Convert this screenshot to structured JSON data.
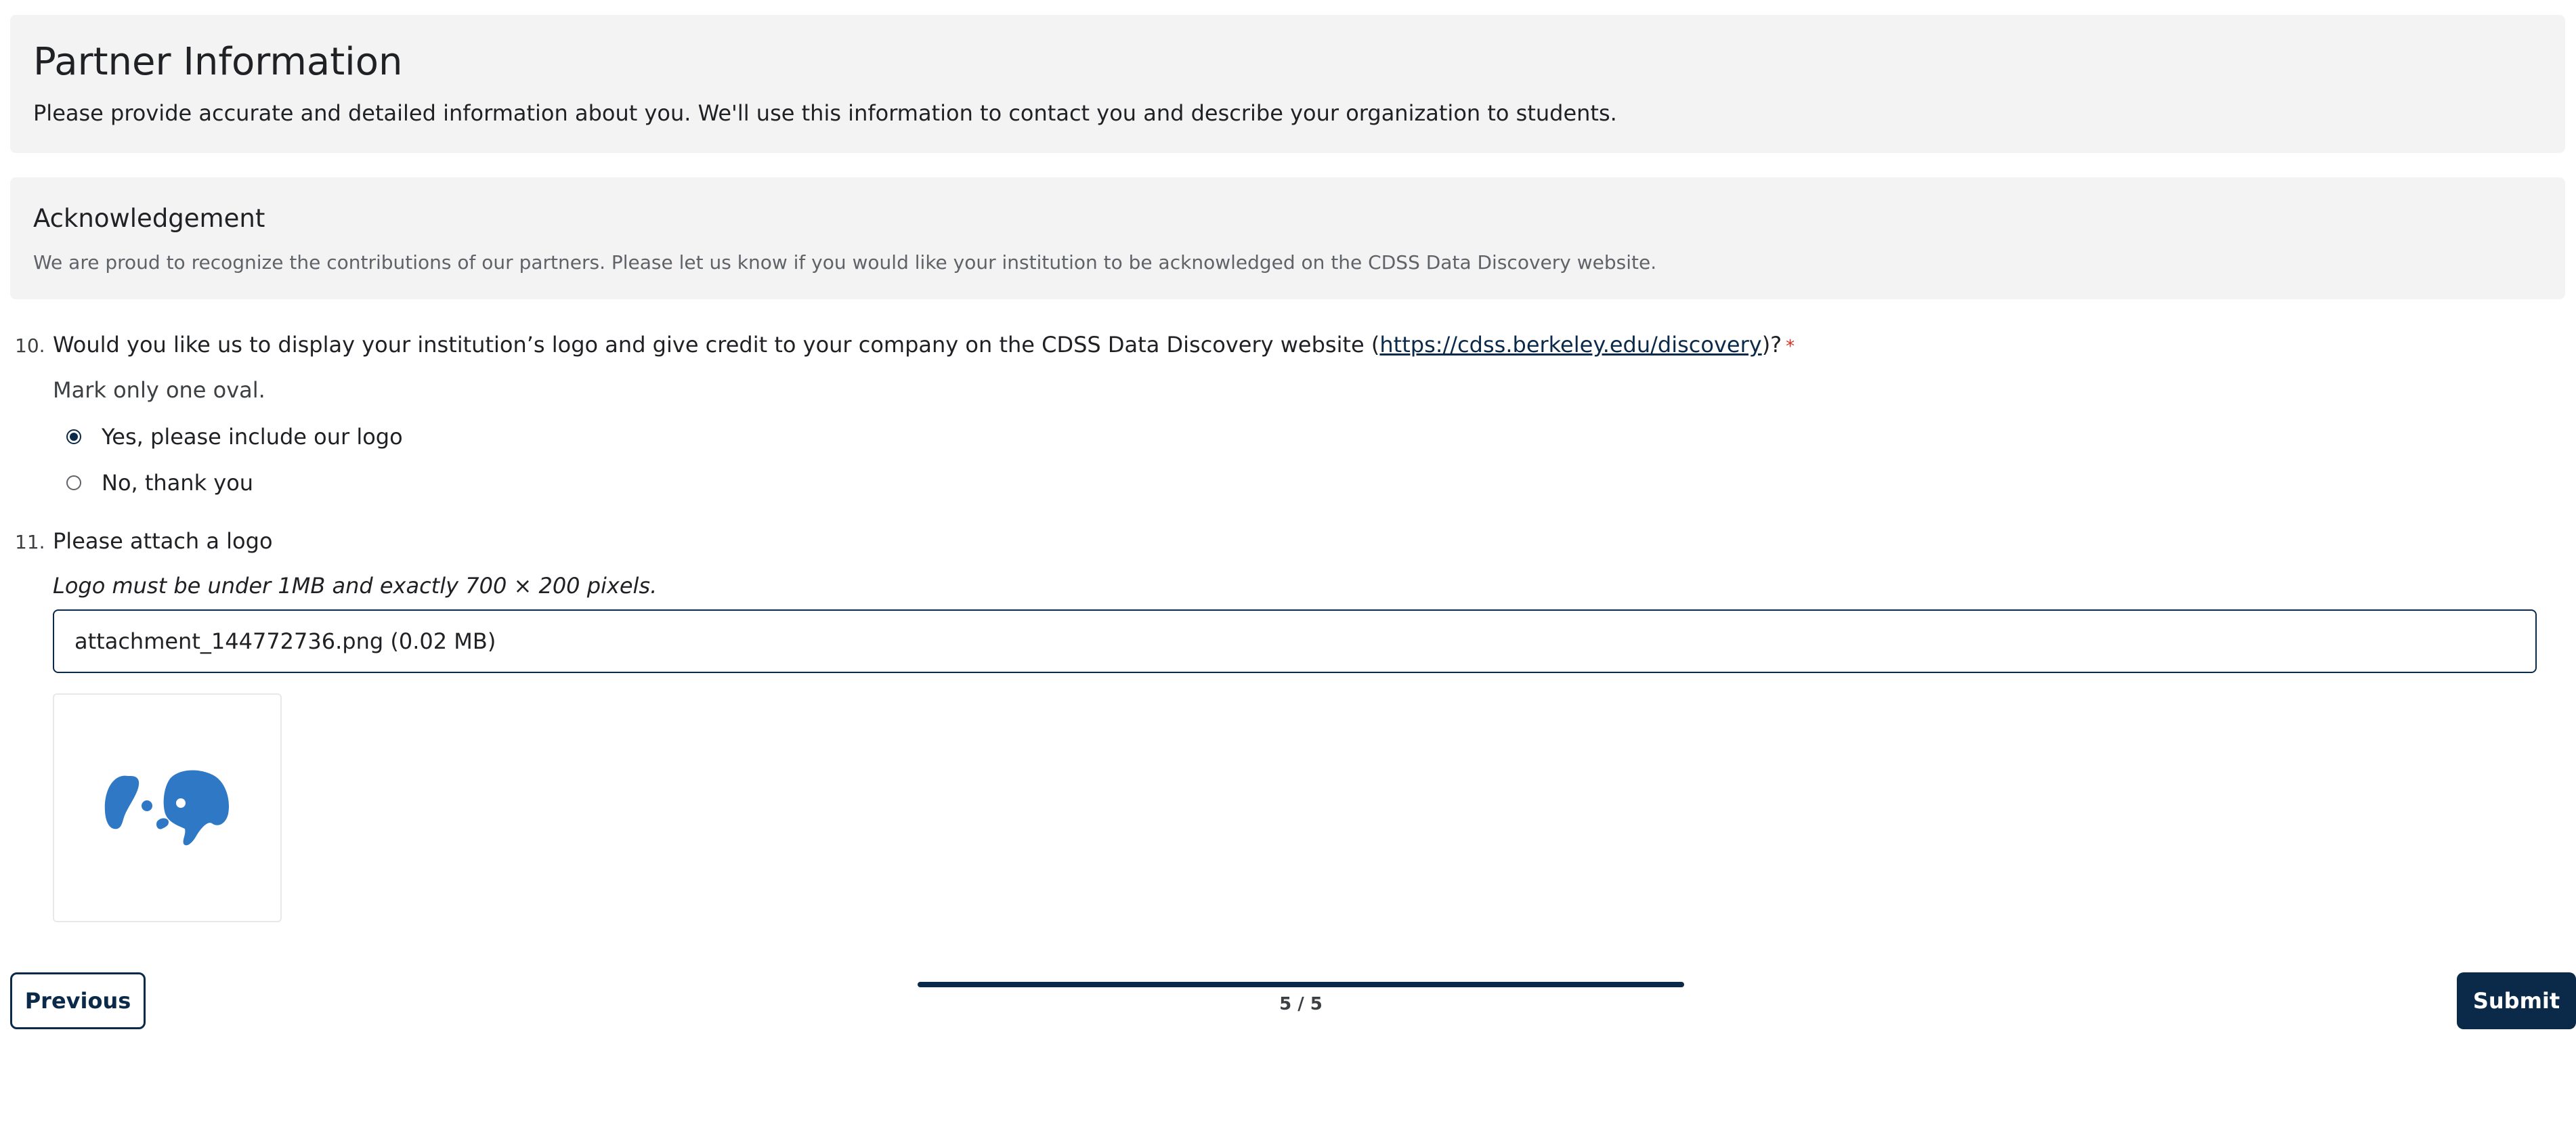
{
  "header": {
    "title": "Partner Information",
    "description": "Please provide accurate and detailed information about you. We'll use this information to contact you and describe your organization to students."
  },
  "section": {
    "title": "Acknowledgement",
    "description": "We are proud to recognize the contributions of our partners. Please let us know if you would like your institution to be acknowledged on the CDSS Data Discovery website."
  },
  "q10": {
    "number": "10.",
    "text_before": "Would you like us to display your institution’s logo and give credit to your company on the CDSS Data Discovery website (",
    "link_text": "https://cdss.berkeley.edu/discovery",
    "text_after": ")?",
    "required_mark": "*",
    "hint": "Mark only one oval.",
    "options": [
      {
        "label": "Yes, please include our logo",
        "selected": true
      },
      {
        "label": "No, thank you",
        "selected": false
      }
    ]
  },
  "q11": {
    "number": "11.",
    "text": "Please attach a logo",
    "hint": "Logo must be under 1MB and exactly 700 × 200 pixels.",
    "file_value": "attachment_144772736.png (0.02 MB)",
    "preview_icon": "dog-logo-icon"
  },
  "nav": {
    "previous_label": "Previous",
    "submit_label": "Submit",
    "progress_text": "5 / 5",
    "progress_fraction": 1.0
  },
  "colors": {
    "accent": "#0b2a4a",
    "logo_blue": "#2f78c6",
    "card_bg": "#f3f3f3",
    "required": "#d93025"
  }
}
